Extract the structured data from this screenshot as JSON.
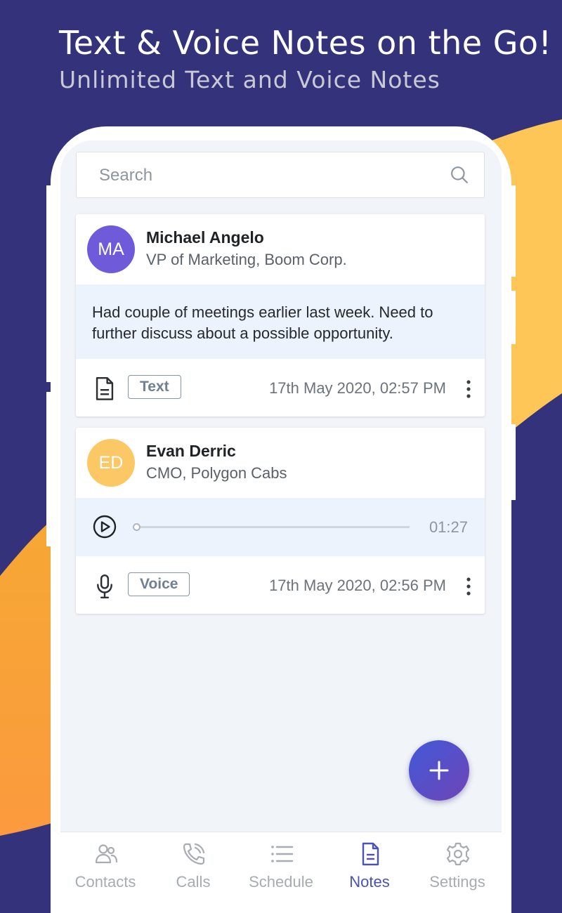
{
  "promo": {
    "headline": "Text & Voice Notes on the Go!",
    "subheadline": "Unlimited Text and Voice Notes"
  },
  "search": {
    "placeholder": "Search"
  },
  "notes": [
    {
      "initials": "MA",
      "avatar_color": "#6f5bd9",
      "name": "Michael Angelo",
      "role": "VP of Marketing, Boom Corp.",
      "body": "Had couple of meetings earlier last week. Need to further discuss about a possible opportunity.",
      "type_icon": "document-icon",
      "type_label": "Text",
      "date": "17th May 2020, 02:57 PM"
    },
    {
      "initials": "ED",
      "avatar_color": "#fcc765",
      "name": "Evan Derric",
      "role": "CMO, Polygon Cabs",
      "audio": {
        "duration": "01:27",
        "progress": 0
      },
      "type_icon": "microphone-icon",
      "type_label": "Voice",
      "date": "17th May 2020, 02:56 PM"
    }
  ],
  "fab": {
    "icon": "plus-icon"
  },
  "nav": {
    "items": [
      {
        "label": "Contacts",
        "icon": "contacts-icon",
        "active": false
      },
      {
        "label": "Calls",
        "icon": "phone-call-icon",
        "active": false
      },
      {
        "label": "Schedule",
        "icon": "list-icon",
        "active": false
      },
      {
        "label": "Notes",
        "icon": "notes-icon",
        "active": true
      },
      {
        "label": "Settings",
        "icon": "gear-icon",
        "active": false
      }
    ]
  },
  "colors": {
    "background": "#33327a",
    "accent_yellow": "#fdc657",
    "accent_orange": "#f8a136",
    "nav_active": "#4a52b8",
    "nav_inactive": "#a7acb2",
    "fab_gradient": [
      "#4158d8",
      "#7045b6"
    ]
  }
}
